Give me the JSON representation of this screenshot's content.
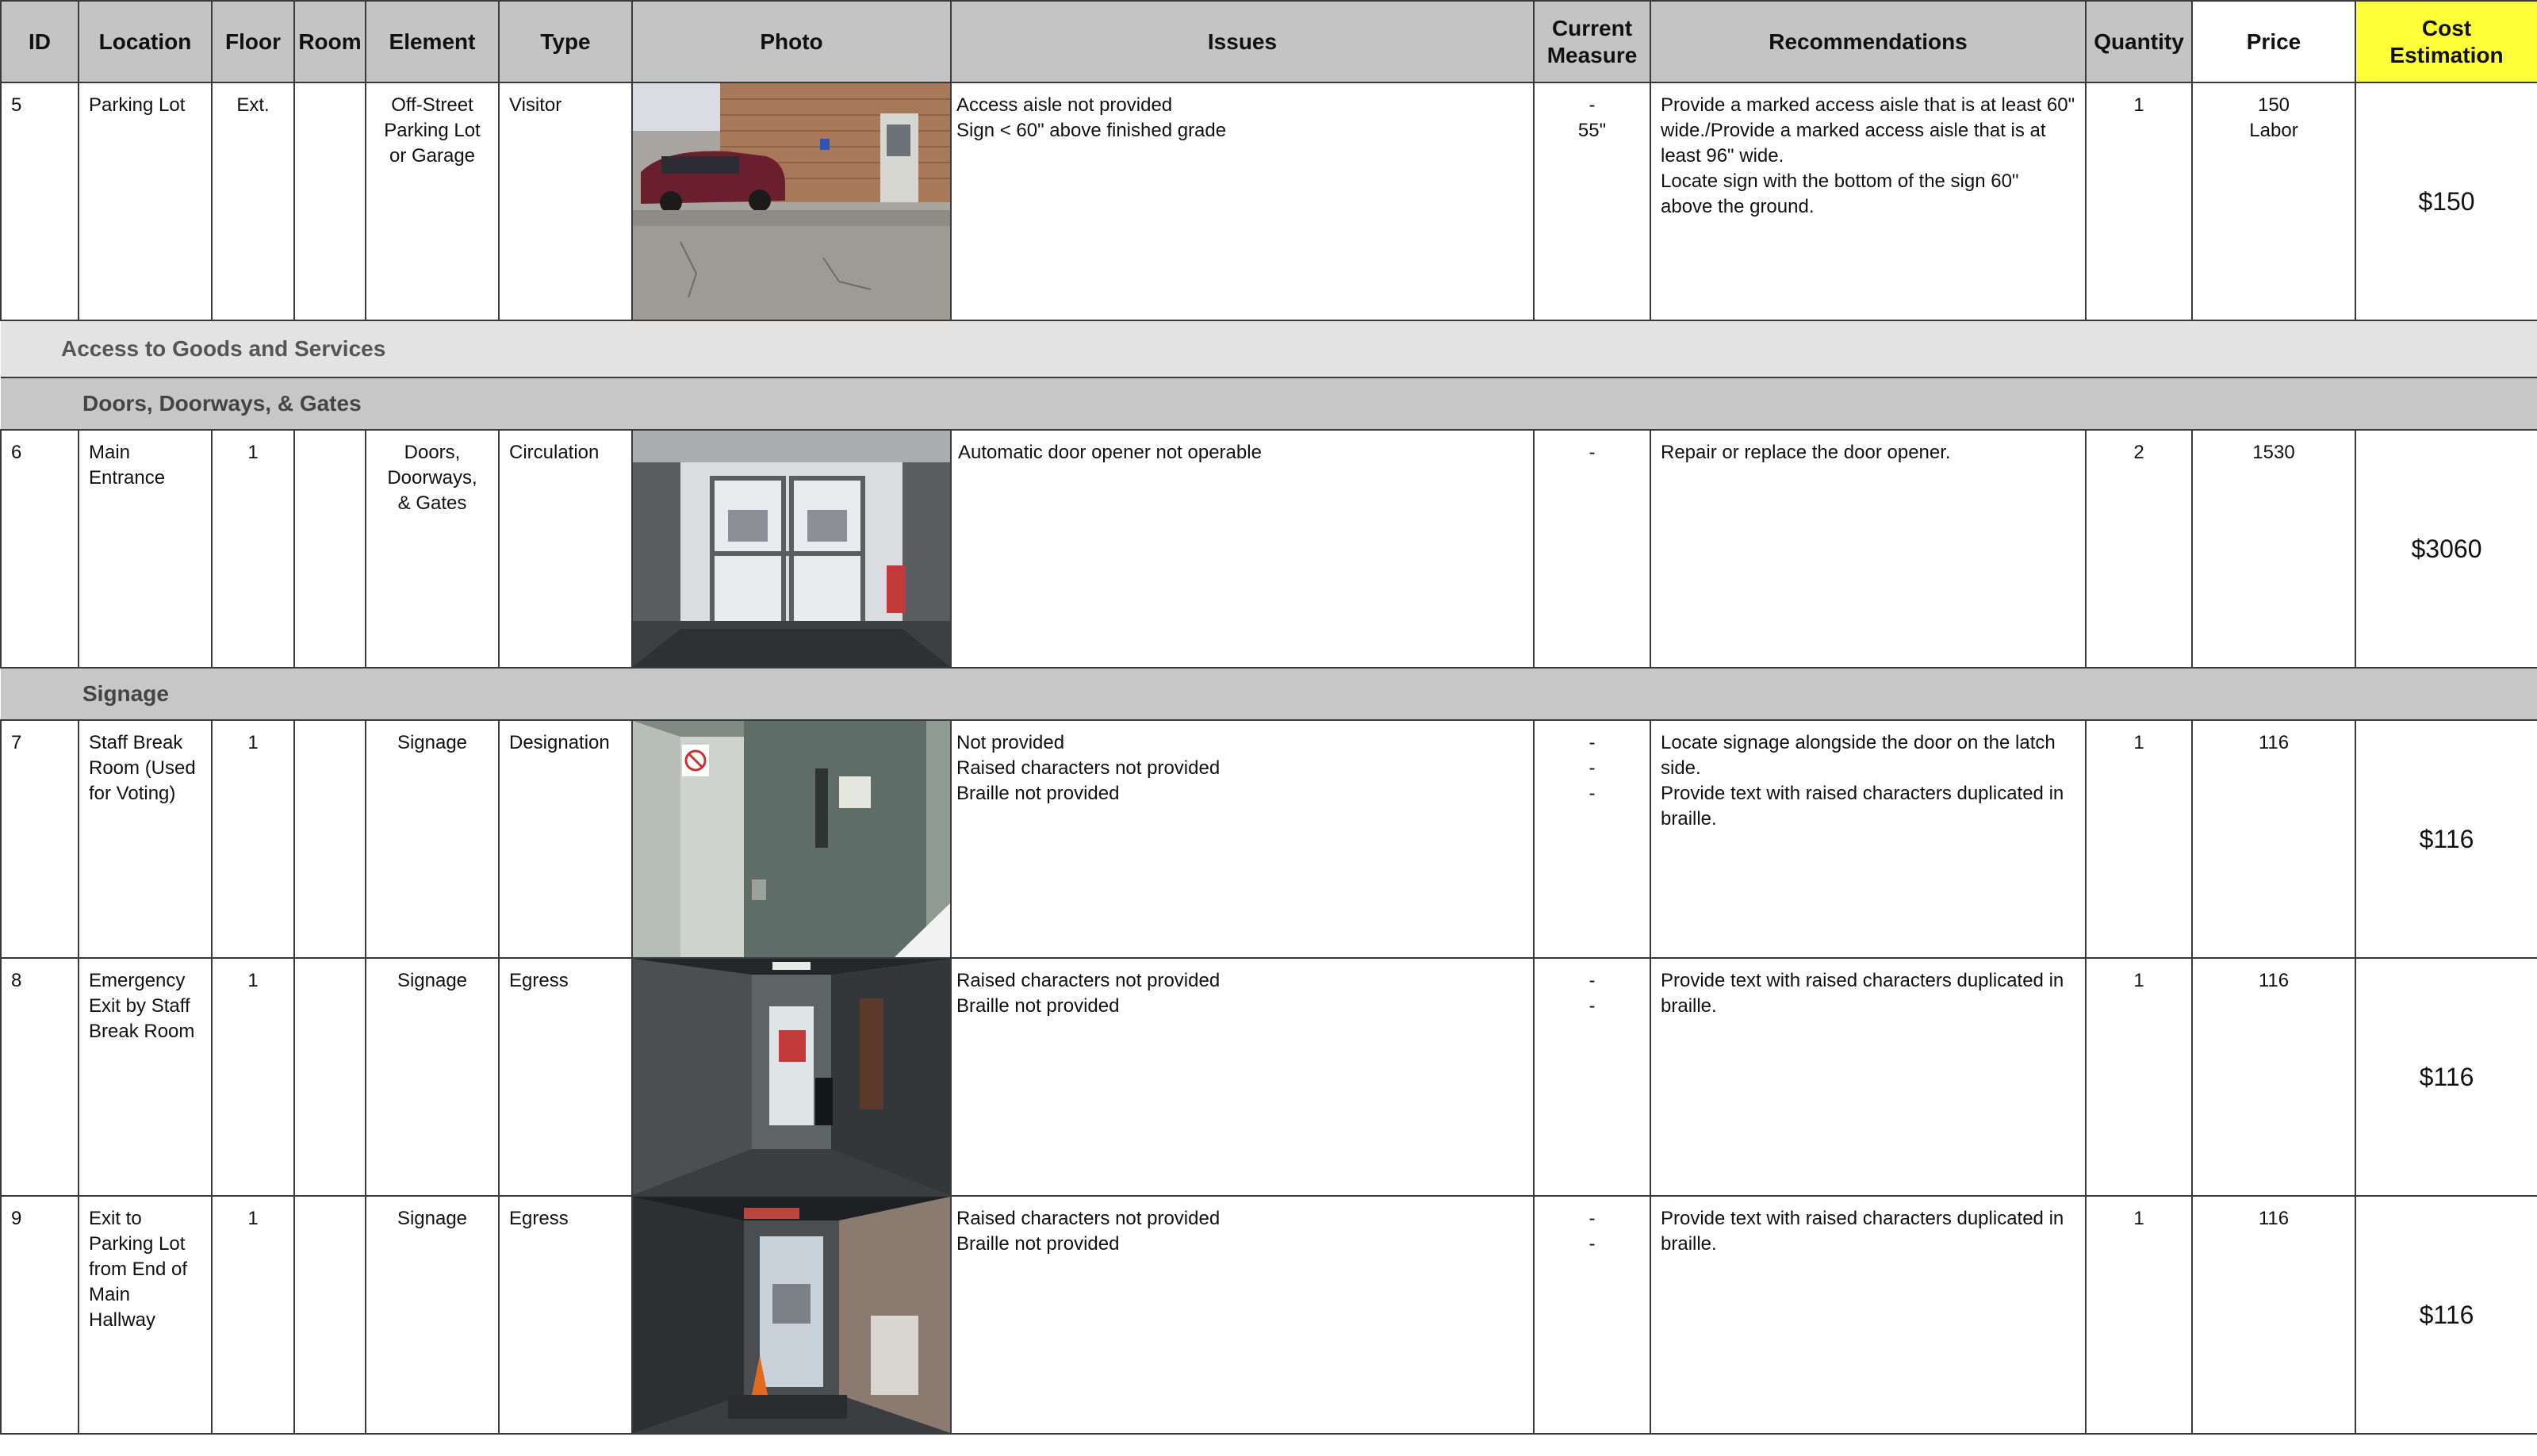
{
  "headers": {
    "id": "ID",
    "location": "Location",
    "floor": "Floor",
    "room": "Room",
    "element": "Element",
    "type": "Type",
    "photo": "Photo",
    "issues": "Issues",
    "current_measure": "Current\nMeasure",
    "recommendations": "Recommendations",
    "quantity": "Quantity",
    "price": "Price",
    "cost_estimation": "Cost\nEstimation"
  },
  "sections": {
    "access": "Access to Goods and Services",
    "doors": "Doors, Doorways, & Gates",
    "signage": "Signage"
  },
  "rows": [
    {
      "id": "5",
      "location": "Parking Lot",
      "floor": "Ext.",
      "room": "",
      "element": "Off-Street\nParking Lot\nor Garage",
      "type": "Visitor",
      "issues": "Access aisle not provided\nSign < 60\" above finished grade",
      "current_measure": "-\n55\"",
      "recommendations": "Provide a marked access aisle that is at least 60\" wide./Provide a marked access aisle that is at least 96\" wide.\nLocate sign with the bottom of the sign 60\" above the ground.",
      "quantity": "1",
      "price": "150\nLabor",
      "cost": "$150"
    },
    {
      "id": "6",
      "location": "Main\nEntrance",
      "floor": "1",
      "room": "",
      "element": "Doors,\nDoorways,\n& Gates",
      "type": "Circulation",
      "issues": "Automatic door opener not operable",
      "current_measure": "-",
      "recommendations": "Repair or replace the door opener.",
      "quantity": "2",
      "price": "1530",
      "cost": "$3060"
    },
    {
      "id": "7",
      "location": "Staff Break\nRoom (Used\nfor Voting)",
      "floor": "1",
      "room": "",
      "element": "Signage",
      "type": "Designation",
      "issues": "Not provided\nRaised characters not provided\nBraille not provided",
      "current_measure": "-\n-\n-",
      "recommendations": "Locate signage alongside the door on the latch side.\nProvide text with raised characters duplicated in braille.",
      "quantity": "1",
      "price": "116",
      "cost": "$116"
    },
    {
      "id": "8",
      "location": "Emergency\nExit by Staff\nBreak Room",
      "floor": "1",
      "room": "",
      "element": "Signage",
      "type": "Egress",
      "issues": "Raised characters not provided\nBraille not provided",
      "current_measure": "-\n-",
      "recommendations": "Provide text with raised characters duplicated in braille.",
      "quantity": "1",
      "price": "116",
      "cost": "$116"
    },
    {
      "id": "9",
      "location": "Exit to\nParking Lot\nfrom End of\nMain Hallway",
      "floor": "1",
      "room": "",
      "element": "Signage",
      "type": "Egress",
      "issues": "Raised characters not provided\nBraille not provided",
      "current_measure": "-\n-",
      "recommendations": "Provide text with raised characters duplicated in braille.",
      "quantity": "1",
      "price": "116",
      "cost": "$116"
    }
  ]
}
